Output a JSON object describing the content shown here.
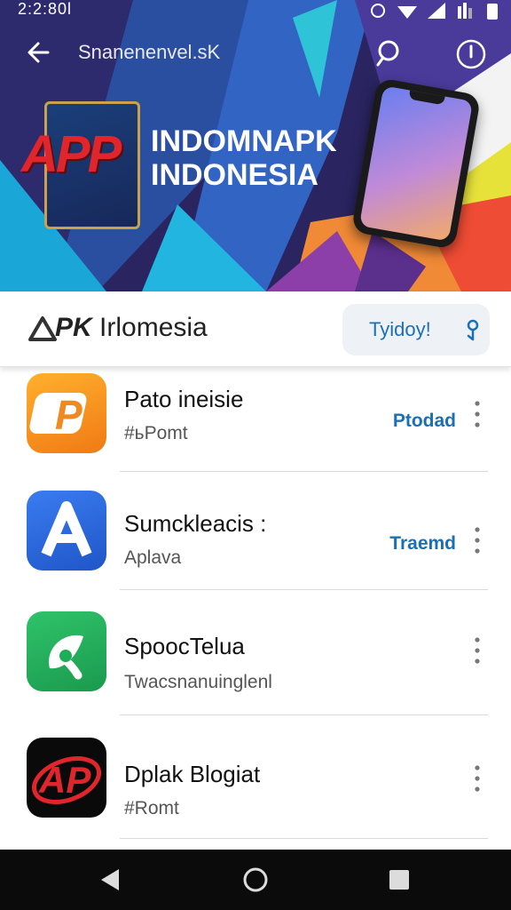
{
  "status_bar": {
    "time": "2:2:80l"
  },
  "top_bar": {
    "title": "Snanenenvel.sK"
  },
  "hero": {
    "logo_text": "APP",
    "title_line1": "INDOMNAPK",
    "title_line2": "INDONESIA"
  },
  "subheader": {
    "brand_prefix": "PK",
    "brand_suffix": " Irlomesia",
    "filter_label": "Tyidoy!"
  },
  "apps": [
    {
      "name": "Pato ineisie",
      "meta": "#ьPomt",
      "action": "Ptodad"
    },
    {
      "name": "Sumckleacis :",
      "meta": "Aplava",
      "action": "Traemd"
    },
    {
      "name": "SpoocTelua",
      "meta": "Twacsnanuinglenl",
      "action": ""
    },
    {
      "name": "Dplak Blogiat",
      "meta": "#Romt",
      "action": ""
    }
  ],
  "colors": {
    "accent": "#1b6fb5",
    "hero_bg": "#2a2460",
    "logo_red": "#e0262c"
  },
  "icons": [
    "back-arrow-icon",
    "search-icon",
    "power-icon",
    "filter-icon",
    "more-vertical-icon",
    "nav-back-icon",
    "nav-home-icon",
    "nav-recents-icon"
  ]
}
